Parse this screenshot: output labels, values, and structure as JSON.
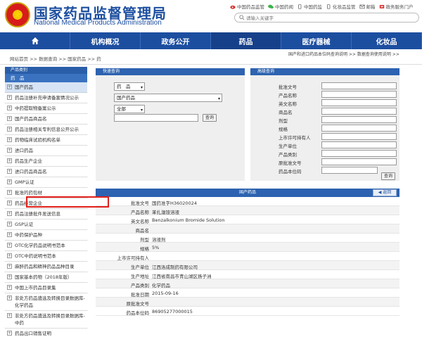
{
  "header": {
    "title": "国家药品监督管理局",
    "subtitle": "National Medical Products Administration",
    "top_links": [
      {
        "label": "中国药品监管",
        "icon": "weibo-icon"
      },
      {
        "label": "中国药闻",
        "icon": "wechat-icon"
      },
      {
        "label": "中国药监",
        "icon": "mobile-icon"
      },
      {
        "label": "化妆品监管",
        "icon": "app-icon"
      },
      {
        "label": "邮箱",
        "icon": "mail-icon"
      },
      {
        "label": "政务服务门户",
        "icon": "portal-icon"
      }
    ],
    "search_placeholder": "请输入关键字"
  },
  "nav": {
    "items": [
      "机构概况",
      "政务公开",
      "药品",
      "医疗器械",
      "化妆品"
    ],
    "active": "药品"
  },
  "breadcrumb": {
    "items": [
      "网站首页",
      "数据查询",
      "国家药品",
      "药"
    ],
    "separator": ">>",
    "right_links": [
      "国产和进口药品本位码查询说明 >>",
      "数据查询使用说明 >>"
    ]
  },
  "sidebar": {
    "head": "产品类别",
    "sub": "药　品",
    "items": [
      "国产药品",
      "药品注册补充申请备案情况公示",
      "中药提取物备案公示",
      "国产药品商品名",
      "药品注册相关专利信息公开公示",
      "药物临床试验机构名单",
      "进口药品",
      "药品生产企业",
      "进口药品商品名",
      "GMP认证",
      "批准的药包材",
      "药品经营企业",
      "药品注册批件发送信息",
      "GSP认证",
      "中药保护品种",
      "OTC化学药品说明书范本",
      "OTC中药说明书范本",
      "麻醉药品和精神药品品种目录",
      "国家基本药物（2018年版）",
      "中国上市药品目录集",
      "非处方药品遴选及转换目录数据库-化学药品",
      "非处方药品遴选及转换目录数据库-中药",
      "药品出口销售证明"
    ],
    "active_index": 0
  },
  "quick": {
    "title": "快速查询",
    "select1": "药　品",
    "select2": "国产药品",
    "select3": "全部",
    "button": "查询"
  },
  "advanced": {
    "title": "高级查询",
    "labels": [
      "批准文号",
      "产品名称",
      "英文名称",
      "商品名",
      "剂型",
      "规格",
      "上市许可持有人",
      "生产单位",
      "产品类别",
      "原批准文号",
      "药品本位码"
    ],
    "button": "查询"
  },
  "result": {
    "title": "国产药品",
    "back": "返回",
    "rows": [
      {
        "label": "批准文号",
        "value": "国药准字H36020024"
      },
      {
        "label": "产品名称",
        "value": "苯扎溴铵溶液"
      },
      {
        "label": "英文名称",
        "value": "Benzalkonium Bromide Solution"
      },
      {
        "label": "商品名",
        "value": ""
      },
      {
        "label": "剂型",
        "value": "溶液剂"
      },
      {
        "label": "规格",
        "value": "5%"
      },
      {
        "label": "上市许可持有人",
        "value": ""
      },
      {
        "label": "生产单位",
        "value": "江西洛成制药有限公司"
      },
      {
        "label": "生产地址",
        "value": "江西省南昌市青山湖区扬子洲"
      },
      {
        "label": "产品类别",
        "value": "化学药品"
      },
      {
        "label": "批准日期",
        "value": "2015-09-16"
      },
      {
        "label": "原批准文号",
        "value": ""
      },
      {
        "label": "药品本位码",
        "value": "86905277000015"
      }
    ]
  },
  "colors": {
    "brand": "#1c4ea0",
    "panel_head": "#2d63b0",
    "highlight": "#e0201b"
  }
}
